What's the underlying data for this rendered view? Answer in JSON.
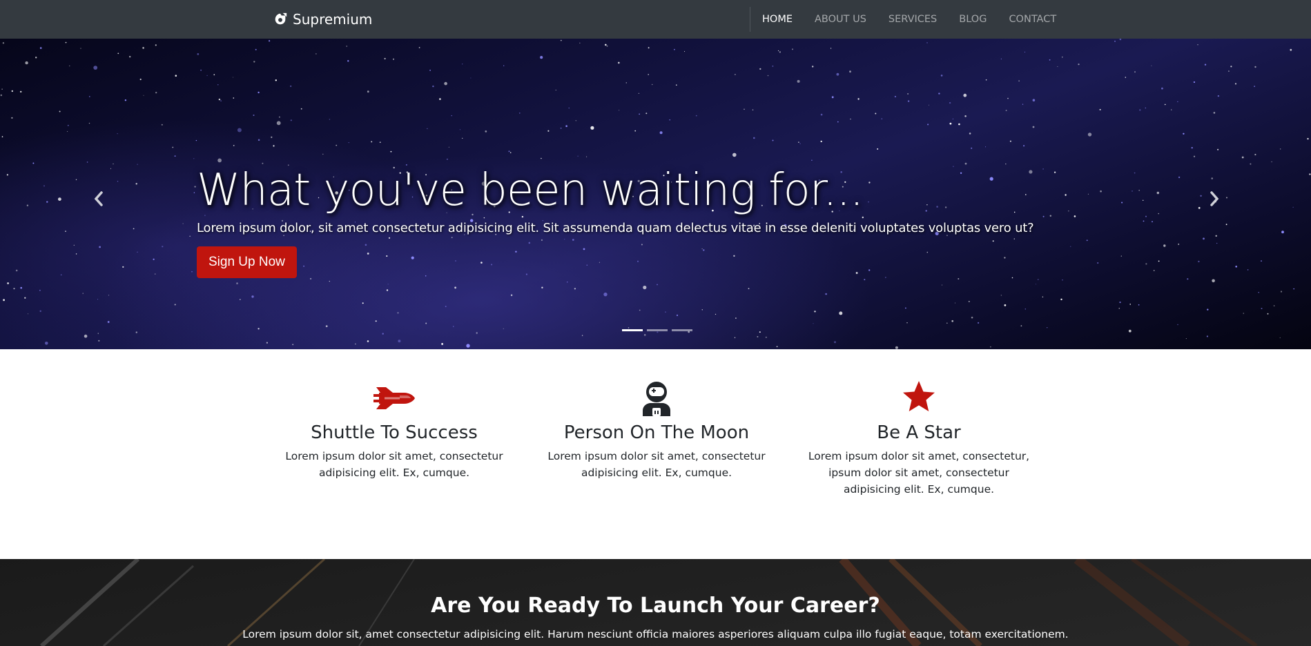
{
  "navbar": {
    "brand": "Supremium",
    "links": [
      {
        "label": "HOME",
        "active": true
      },
      {
        "label": "ABOUT US",
        "active": false
      },
      {
        "label": "SERVICES",
        "active": false
      },
      {
        "label": "BLOG",
        "active": false
      },
      {
        "label": "CONTACT",
        "active": false
      }
    ],
    "colors": {
      "background": "#343a40",
      "active": "#ffffff",
      "inactive": "rgba(255,255,255,0.55)"
    }
  },
  "hero": {
    "title": "What you've been waiting for...",
    "text": "Lorem ipsum dolor, sit amet consectetur adipisicing elit. Sit assumenda quam delectus vitae in esse deleniti voluptates voluptas vero ut?",
    "button_label": "Sign Up Now",
    "button_color": "#c0150e",
    "slide_count": 3,
    "active_slide": 0,
    "icons": {
      "prev": "chevron-left-icon",
      "next": "chevron-right-icon"
    }
  },
  "features": [
    {
      "icon": "space-shuttle-icon",
      "title": "Shuttle To Success",
      "text": "Lorem ipsum dolor sit amet, consectetur adipisicing elit. Ex, cumque.",
      "icon_color": "#c0150e"
    },
    {
      "icon": "astronaut-icon",
      "title": "Person On The Moon",
      "text": "Lorem ipsum dolor sit amet, consectetur adipisicing elit. Ex, cumque.",
      "icon_color": "#212529"
    },
    {
      "icon": "star-icon",
      "title": "Be A Star",
      "text": "Lorem ipsum dolor sit amet, consectetur, ipsum dolor sit amet, consectetur adipisicing elit. Ex, cumque.",
      "icon_color": "#c0150e"
    }
  ],
  "cta": {
    "title": "Are You Ready To Launch Your Career?",
    "text": "Lorem ipsum dolor sit, amet consectetur adipisicing elit. Harum nesciunt officia maiores asperiores aliquam culpa illo fugiat eaque, totam exercitationem."
  }
}
